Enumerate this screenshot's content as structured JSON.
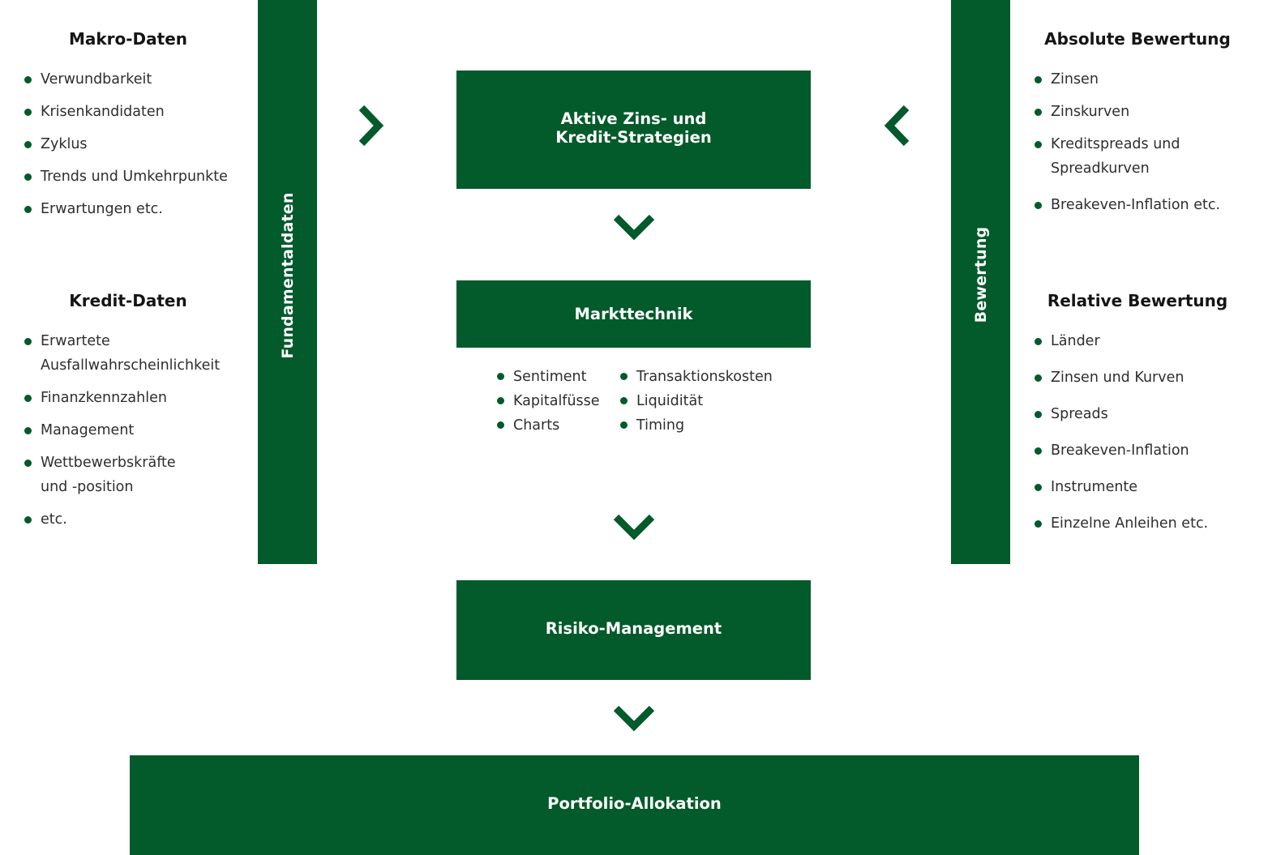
{
  "colors": {
    "primary_green": "#035a2a",
    "text_dark": "#151515",
    "text_body": "#2e2e2e",
    "background": "#ffffff"
  },
  "left_column": {
    "makro": {
      "title": "Makro-Daten",
      "items": [
        "Verwundbarkeit",
        "Krisenkandidaten",
        "Zyklus",
        "Trends und Umkehrpunkte",
        "Erwartungen etc."
      ]
    },
    "kredit": {
      "title": "Kredit-Daten",
      "items": [
        "Erwartete Ausfallwahrscheinlichkeit",
        "Finanzkennzahlen",
        "Management",
        "Wettbewerbskräfte und -position",
        "etc."
      ]
    }
  },
  "left_bar": {
    "label": "Fundamentaldaten"
  },
  "right_bar": {
    "label": "Bewertung"
  },
  "right_column": {
    "absolute": {
      "title": "Absolute Bewertung",
      "items": [
        "Zinsen",
        "Zinskurven",
        "Kreditspreads und Spreadkurven",
        "Breakeven-Inflation etc."
      ]
    },
    "relative": {
      "title": "Relative Bewertung",
      "items": [
        "Länder",
        "Zinsen und Kurven",
        "Spreads",
        "Breakeven-Inflation",
        "Instrumente",
        "Einzelne Anleihen etc."
      ]
    }
  },
  "center": {
    "strategies": {
      "line1": "Aktive Zins- und",
      "line2": "Kredit-Strategien"
    },
    "markttechnik": {
      "title": "Markttechnik",
      "col1": [
        "Sentiment",
        "Kapitalfüsse",
        "Charts"
      ],
      "col2": [
        "Transaktionskosten",
        "Liquidität",
        "Timing"
      ]
    },
    "risk": {
      "title": "Risiko-Management"
    },
    "portfolio": {
      "title": "Portfolio-Allokation"
    }
  },
  "icons": {
    "left_arrow": "chevron-right-icon",
    "right_arrow": "chevron-left-icon",
    "down_arrows": [
      "chevron-down-icon",
      "chevron-down-icon",
      "chevron-down-icon"
    ]
  }
}
